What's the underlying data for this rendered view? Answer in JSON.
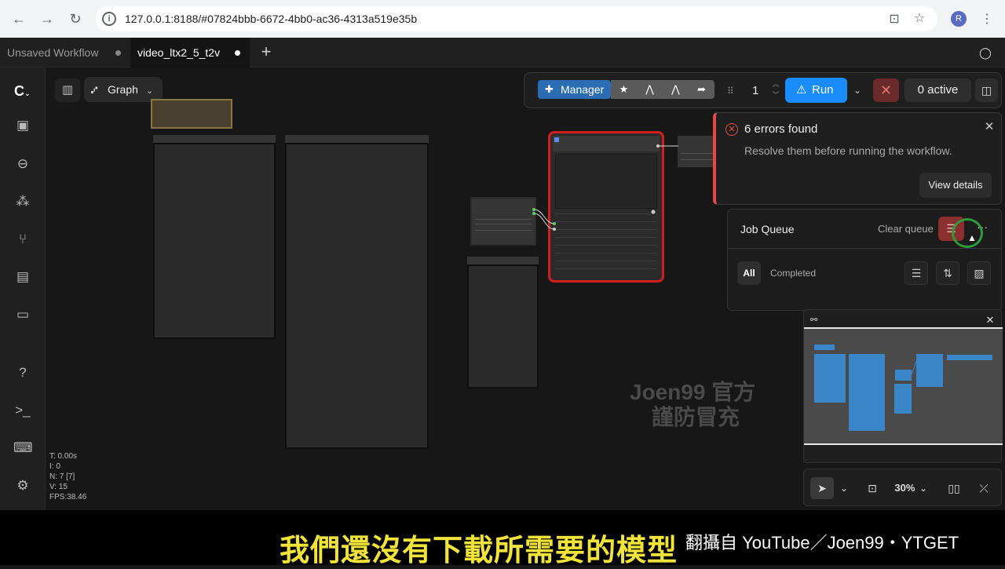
{
  "browser": {
    "url": "127.0.0.1:8188/#07824bbb-6672-4bb0-ac36-4313a519e35b",
    "profile_initial": "R"
  },
  "tabs": [
    {
      "label": "Unsaved Workflow",
      "active": false
    },
    {
      "label": "video_ltx2_5_t2v",
      "active": true
    }
  ],
  "graph_controls": {
    "mode_label": "Graph"
  },
  "stats": {
    "t": "T: 0.00s",
    "i": "I: 0",
    "n": "N: 7 [7]",
    "v": "V: 15",
    "fps": "FPS:38.46"
  },
  "toolbar": {
    "manager_label": "Manager",
    "queue_count": "1",
    "run_label": "Run",
    "active_label": "0 active",
    "run_color": "#1a8cff"
  },
  "errors": {
    "title": "6 errors found",
    "description": "Resolve them before running the workflow.",
    "view_details_label": "View details",
    "accent_color": "#e04c4c"
  },
  "job_queue": {
    "title": "Job Queue",
    "clear_label": "Clear queue",
    "filter_all": "All",
    "filter_completed": "Completed"
  },
  "canvas_controls": {
    "zoom": "30%"
  },
  "watermark": {
    "line1": "Joen99 官方",
    "line2": "謹防冒充"
  },
  "video_overlay": {
    "subtitle": "我們還沒有下載所需要的模型",
    "credit": "翻攝自 YouTube／Joen99・YTGET"
  }
}
